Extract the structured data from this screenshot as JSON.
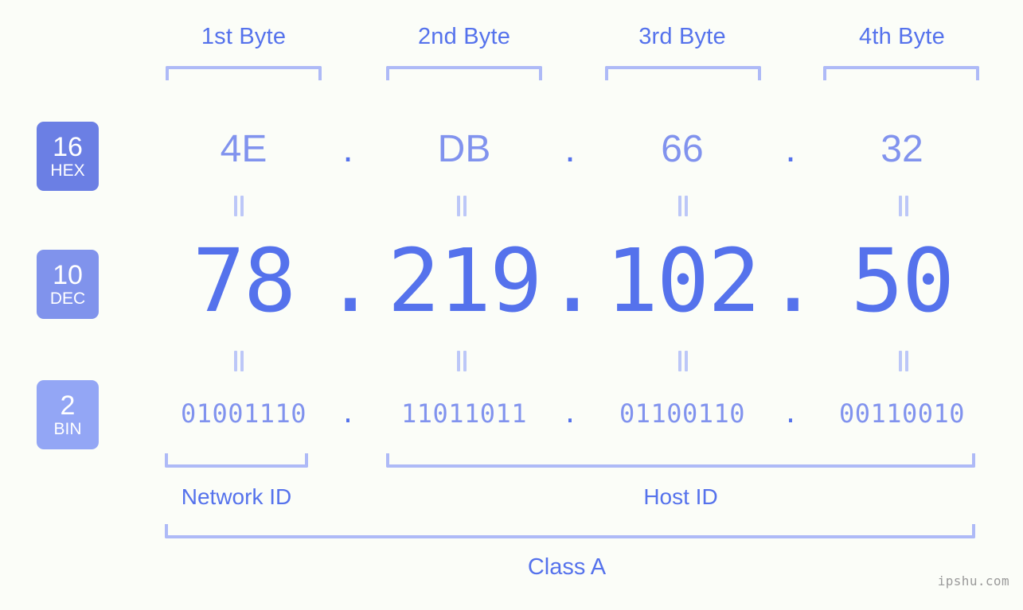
{
  "background_color": "#fbfdf8",
  "colors": {
    "accent_strong": "#5572ec",
    "accent_mid": "#8193ee",
    "accent_light": "#aebaf7",
    "badge_hex": "#6b7fe4",
    "badge_dec": "#8093ec",
    "badge_bin": "#93a6f5",
    "watermark": "#9a9a9a"
  },
  "byte_headers": [
    {
      "label": "1st Byte"
    },
    {
      "label": "2nd Byte"
    },
    {
      "label": "3rd Byte"
    },
    {
      "label": "4th Byte"
    }
  ],
  "rows": {
    "hex": {
      "badge_number": "16",
      "badge_system": "HEX",
      "values": [
        "4E",
        "DB",
        "66",
        "32"
      ],
      "separator": "."
    },
    "dec": {
      "badge_number": "10",
      "badge_system": "DEC",
      "values": [
        "78",
        "219",
        "102",
        "50"
      ],
      "separator": "."
    },
    "bin": {
      "badge_number": "2",
      "badge_system": "BIN",
      "values": [
        "01001110",
        "11011011",
        "01100110",
        "00110010"
      ],
      "separator": "."
    }
  },
  "equality_marks": {
    "glyph": "=",
    "count_per_row": 4,
    "rows": 2
  },
  "sections": {
    "network_id": "Network ID",
    "host_id": "Host ID",
    "class": "Class A"
  },
  "watermark": "ipshu.com"
}
